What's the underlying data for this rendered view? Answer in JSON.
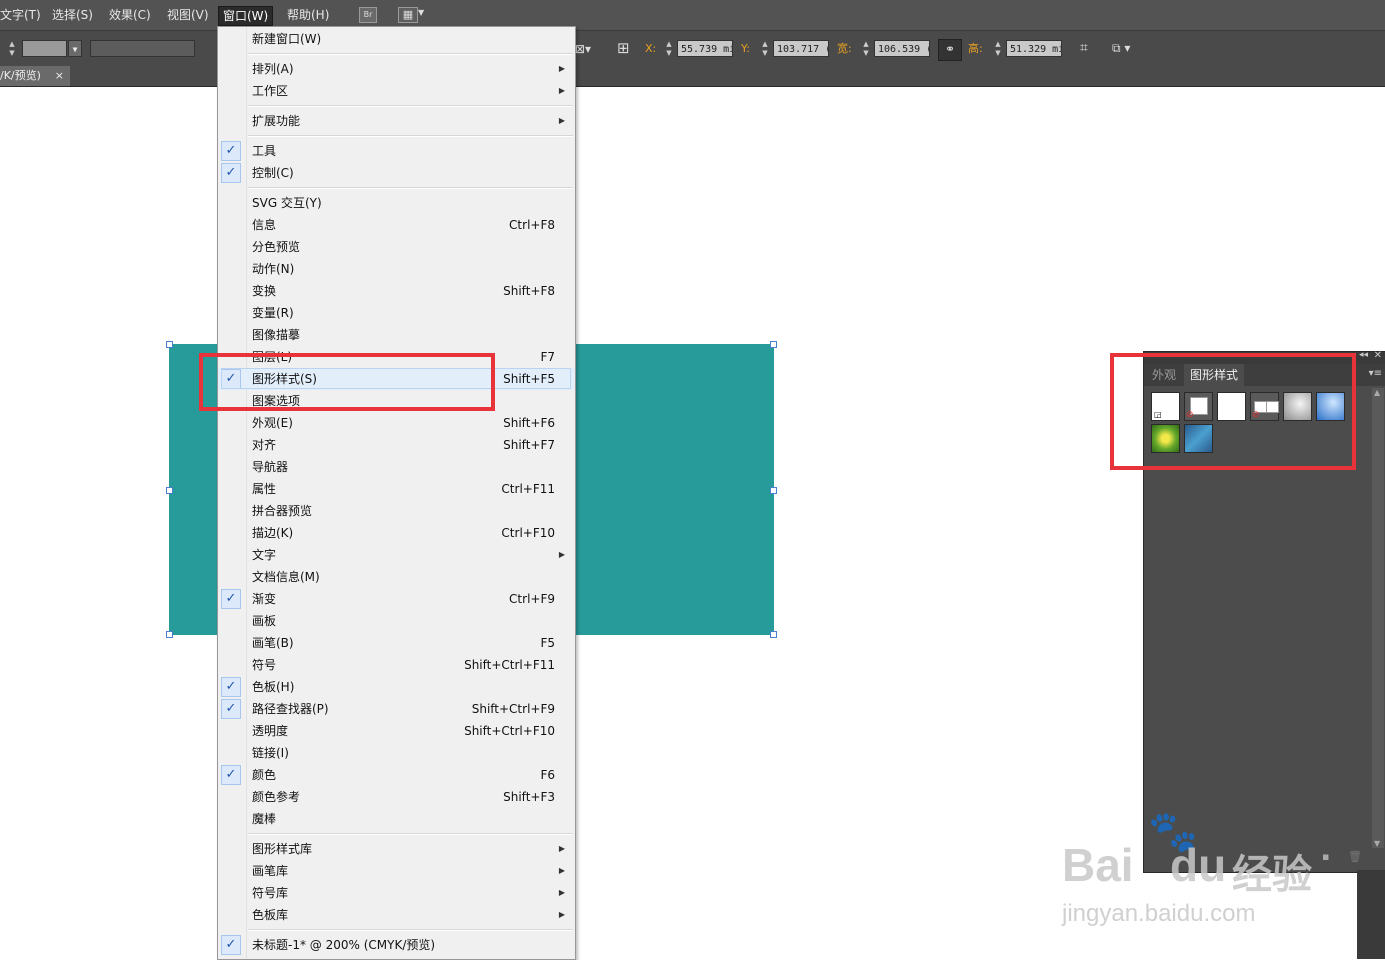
{
  "menubar": {
    "items": [
      "文字(T)",
      "选择(S)",
      "效果(C)",
      "视图(V)",
      "窗口(W)",
      "帮助(H)"
    ],
    "active_index": 4,
    "bridge_label": "Br"
  },
  "control": {
    "x_label": "X:",
    "x_value": "55.739 mi",
    "y_label": "Y:",
    "y_value": "103.717 (",
    "w_label": "宽:",
    "w_value": "106.539 (",
    "h_label": "高:",
    "h_value": "51.329 mi"
  },
  "document_tab": {
    "title": "/K/预览)",
    "close": "×"
  },
  "menu": {
    "items": [
      {
        "label": "新建窗口(W)"
      },
      {
        "sep": true
      },
      {
        "label": "排列(A)",
        "submenu": true
      },
      {
        "label": "工作区",
        "submenu": true
      },
      {
        "sep": true
      },
      {
        "label": "扩展功能",
        "submenu": true
      },
      {
        "sep": true
      },
      {
        "label": "工具",
        "checked": true
      },
      {
        "label": "控制(C)",
        "checked": true
      },
      {
        "sep": true
      },
      {
        "label": "SVG 交互(Y)"
      },
      {
        "label": "信息",
        "shortcut": "Ctrl+F8"
      },
      {
        "label": "分色预览"
      },
      {
        "label": "动作(N)"
      },
      {
        "label": "变换",
        "shortcut": "Shift+F8"
      },
      {
        "label": "变量(R)"
      },
      {
        "label": "图像描摹"
      },
      {
        "label": "图层(L)",
        "shortcut": "F7"
      },
      {
        "label": "图形样式(S)",
        "shortcut": "Shift+F5",
        "checked": true,
        "highlight": true
      },
      {
        "label": "图案选项"
      },
      {
        "label": "外观(E)",
        "shortcut": "Shift+F6"
      },
      {
        "label": "对齐",
        "shortcut": "Shift+F7"
      },
      {
        "label": "导航器"
      },
      {
        "label": "属性",
        "shortcut": "Ctrl+F11"
      },
      {
        "label": "拼合器预览"
      },
      {
        "label": "描边(K)",
        "shortcut": "Ctrl+F10"
      },
      {
        "label": "文字",
        "submenu": true
      },
      {
        "label": "文档信息(M)"
      },
      {
        "label": "渐变",
        "shortcut": "Ctrl+F9",
        "checked": true
      },
      {
        "label": "画板"
      },
      {
        "label": "画笔(B)",
        "shortcut": "F5"
      },
      {
        "label": "符号",
        "shortcut": "Shift+Ctrl+F11"
      },
      {
        "label": "色板(H)",
        "checked": true
      },
      {
        "label": "路径查找器(P)",
        "shortcut": "Shift+Ctrl+F9",
        "checked": true
      },
      {
        "label": "透明度",
        "shortcut": "Shift+Ctrl+F10"
      },
      {
        "label": "链接(I)"
      },
      {
        "label": "颜色",
        "shortcut": "F6",
        "checked": true
      },
      {
        "label": "颜色参考",
        "shortcut": "Shift+F3"
      },
      {
        "label": "魔棒"
      },
      {
        "sep": true
      },
      {
        "label": "图形样式库",
        "submenu": true
      },
      {
        "label": "画笔库",
        "submenu": true
      },
      {
        "label": "符号库",
        "submenu": true
      },
      {
        "label": "色板库",
        "submenu": true
      },
      {
        "sep": true
      },
      {
        "label": "未标题-1* @ 200% (CMYK/预览)",
        "checked": true
      }
    ]
  },
  "panel": {
    "tabs": [
      "外观",
      "图形样式"
    ],
    "active_tab": 1,
    "swatches": [
      "default-style",
      "no-fill-style",
      "white-style",
      "double-box-style",
      "grey-gradient-style",
      "blue-gradient-style",
      "green-texture-style",
      "blue-texture-style"
    ]
  },
  "watermark": {
    "brand": "Bai",
    "brand2": "du",
    "cn": "经验",
    "url": "jingyan.baidu.com"
  },
  "colors": {
    "canvas_rect": "#279a9a",
    "highlight_box": "#e8333a"
  }
}
